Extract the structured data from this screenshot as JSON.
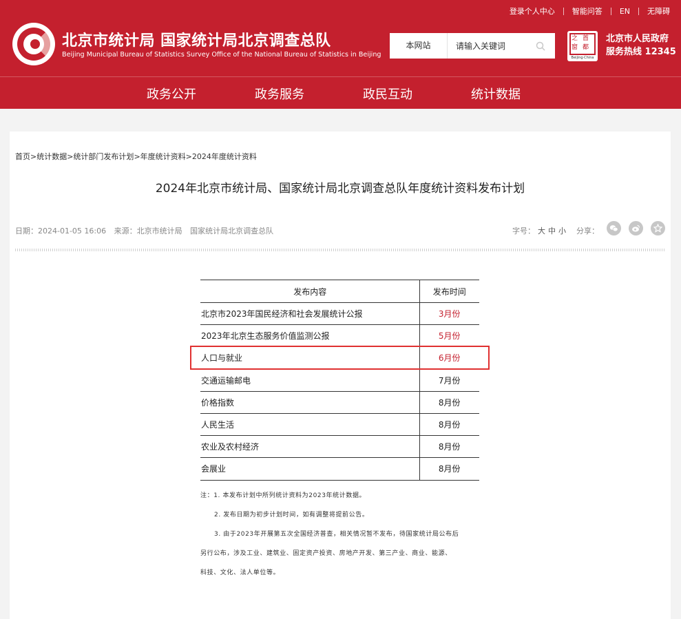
{
  "header": {
    "toplinks": [
      "登录个人中心",
      "智能问答",
      "EN",
      "无障碍"
    ],
    "site_title": "北京市统计局  国家统计局北京调查总队",
    "site_subtitle": "Beijing Municipal Bureau of Statistics  Survey Office of the National Bureau of Statistics in Beijing",
    "search": {
      "scope": "本网站",
      "placeholder": "请输入关键词"
    },
    "capital_logo": {
      "glyphs": [
        "之",
        "首",
        "窗",
        "都"
      ],
      "caption": "Beijing·China"
    },
    "gov_line1": "北京市人民政府",
    "gov_line2": "服务热线 12345",
    "nav": [
      "政务公开",
      "政务服务",
      "政民互动",
      "统计数据"
    ]
  },
  "breadcrumb": [
    "首页",
    "统计数据",
    "统计部门发布计划",
    "年度统计资料",
    "2024年度统计资料"
  ],
  "article": {
    "title": "2024年北京市统计局、国家统计局北京调查总队年度统计资料发布计划",
    "date": "日期：2024-01-05 16:06",
    "source_label": "来源：北京市统计局",
    "source_extra": "国家统计局北京调查总队",
    "fontsize_label": "字号：",
    "fontsize_options": [
      "大",
      "中",
      "小"
    ],
    "share_label": "分享：",
    "share_icons": [
      "wechat-icon",
      "weibo-icon",
      "favorite-icon"
    ]
  },
  "table": {
    "headers": [
      "发布内容",
      "发布时间"
    ],
    "rows": [
      {
        "content": "北京市2023年国民经济和社会发展统计公报",
        "time": "3月份",
        "highlight_color": "#c4202e"
      },
      {
        "content": "2023年北京生态服务价值监测公报",
        "time": "5月份",
        "highlight_color": "#c4202e"
      },
      {
        "content": "人口与就业",
        "time": "6月份",
        "highlight_color": "#c4202e"
      },
      {
        "content": "交通运输邮电",
        "time": "7月份"
      },
      {
        "content": "价格指数",
        "time": "8月份"
      },
      {
        "content": "人民生活",
        "time": "8月份"
      },
      {
        "content": "农业及农村经济",
        "time": "8月份"
      },
      {
        "content": "会展业",
        "time": "8月份"
      }
    ]
  },
  "notes": [
    "注：1. 本发布计划中所列统计资料为2023年统计数据。",
    "2. 发布日期为初步计划时间，如有调整将提前公告。",
    "3. 由于2023年开展第五次全国经济普查，相关情况暂不发布，待国家统计局公布后",
    "另行公布，涉及工业、建筑业、固定资产投资、房地产开发、第三产业、商业、能源、",
    "科技、文化、法人单位等。"
  ],
  "colors": {
    "brand_red": "#c4202e",
    "highlight_box": "#e03030"
  }
}
